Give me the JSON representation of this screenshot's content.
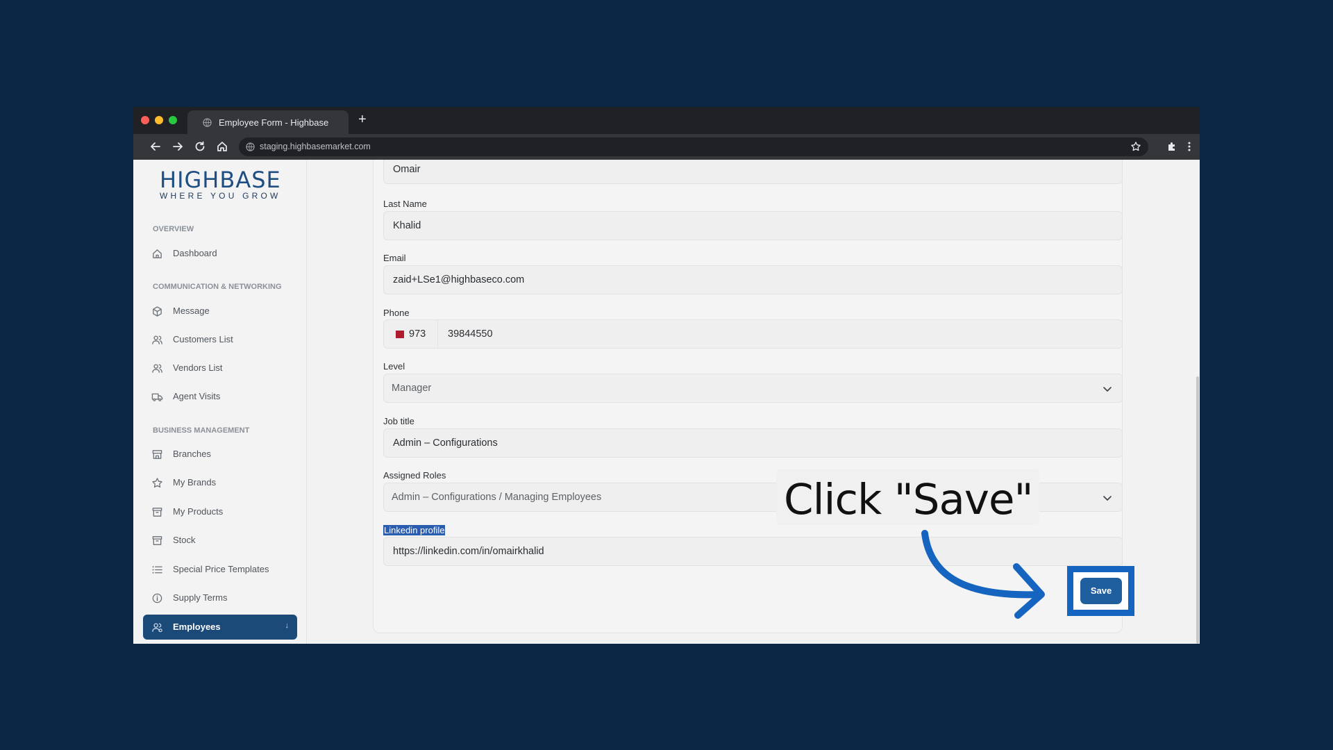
{
  "browser": {
    "tab_title": "Employee Form - Highbase",
    "new_tab_glyph": "+",
    "url": "staging.highbasemarket.com"
  },
  "logo": {
    "name": "HIGHBASE",
    "tagline": "WHERE YOU GROW"
  },
  "sidebar": {
    "sections": [
      {
        "label": "OVERVIEW"
      },
      {
        "label": "COMMUNICATION & NETWORKING"
      },
      {
        "label": "BUSINESS MANAGEMENT"
      }
    ],
    "items": [
      {
        "label": "Dashboard",
        "icon": "home-icon"
      },
      {
        "label": "Message",
        "icon": "cube-icon"
      },
      {
        "label": "Customers List",
        "icon": "users-icon"
      },
      {
        "label": "Vendors List",
        "icon": "users-icon"
      },
      {
        "label": "Agent Visits",
        "icon": "truck-icon"
      },
      {
        "label": "Branches",
        "icon": "store-icon"
      },
      {
        "label": "My Brands",
        "icon": "star-icon"
      },
      {
        "label": "My Products",
        "icon": "box-icon"
      },
      {
        "label": "Stock",
        "icon": "box-icon"
      },
      {
        "label": "Special Price Templates",
        "icon": "list-icon"
      },
      {
        "label": "Supply Terms",
        "icon": "info-icon"
      },
      {
        "label": "Employees",
        "icon": "users-cog-icon",
        "active": true
      }
    ]
  },
  "form": {
    "first_name_value": "Omair",
    "last_name_label": "Last Name",
    "last_name_value": "Khalid",
    "email_label": "Email",
    "email_value": "zaid+LSe1@highbaseco.com",
    "phone_label": "Phone",
    "phone_code": "973",
    "phone_number": "39844550",
    "level_label": "Level",
    "level_value": "Manager",
    "job_title_label": "Job title",
    "job_title_value": "Admin – Configurations",
    "roles_label": "Assigned Roles",
    "roles_value": "Admin – Configurations / Managing Employees",
    "linkedin_label": "Linkedin profile",
    "linkedin_value": "https://linkedin.com/in/omairkhalid",
    "save_label": "Save"
  },
  "callout": {
    "text": "Click \"Save\""
  },
  "colors": {
    "accent": "#1c4a78",
    "highlight": "#1565c0",
    "background": "#0c2646"
  }
}
